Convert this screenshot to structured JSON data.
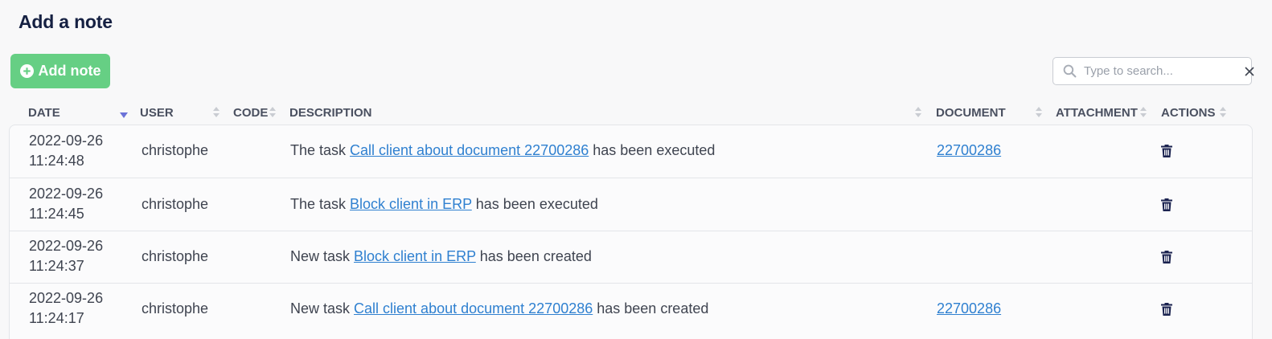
{
  "page": {
    "title": "Add a note"
  },
  "toolbar": {
    "add_label": "Add note",
    "search_placeholder": "Type to search..."
  },
  "table": {
    "columns": [
      "DATE",
      "USER",
      "CODE",
      "DESCRIPTION",
      "DOCUMENT",
      "ATTACHMENT",
      "ACTIONS"
    ],
    "sorted_column": "DATE",
    "sort_direction": "descending",
    "rows": [
      {
        "date": "2022-09-26",
        "time": "11:24:48",
        "user": "christophe",
        "code": "",
        "desc_before": "The task ",
        "desc_link": "Call client about document 22700286",
        "desc_after": " has been executed",
        "document": "22700286",
        "attachment": ""
      },
      {
        "date": "2022-09-26",
        "time": "11:24:45",
        "user": "christophe",
        "code": "",
        "desc_before": "The task ",
        "desc_link": "Block client in ERP",
        "desc_after": " has been executed",
        "document": "",
        "attachment": ""
      },
      {
        "date": "2022-09-26",
        "time": "11:24:37",
        "user": "christophe",
        "code": "",
        "desc_before": "New task ",
        "desc_link": "Block client in ERP",
        "desc_after": " has been created",
        "document": "",
        "attachment": ""
      },
      {
        "date": "2022-09-26",
        "time": "11:24:17",
        "user": "christophe",
        "code": "",
        "desc_before": "New task ",
        "desc_link": "Call client about document 22700286",
        "desc_after": " has been created",
        "document": "22700286",
        "attachment": ""
      }
    ]
  },
  "colors": {
    "accent_green": "#66cf84",
    "link_blue": "#2f80d0",
    "title_navy": "#152042",
    "trash_navy": "#1b2350",
    "sort_active": "#6b72d8"
  },
  "icons": {
    "add": "plus-circle-icon",
    "search": "search-icon",
    "clear": "close-icon",
    "delete": "trash-icon",
    "sort": "sort-arrows-icon"
  }
}
